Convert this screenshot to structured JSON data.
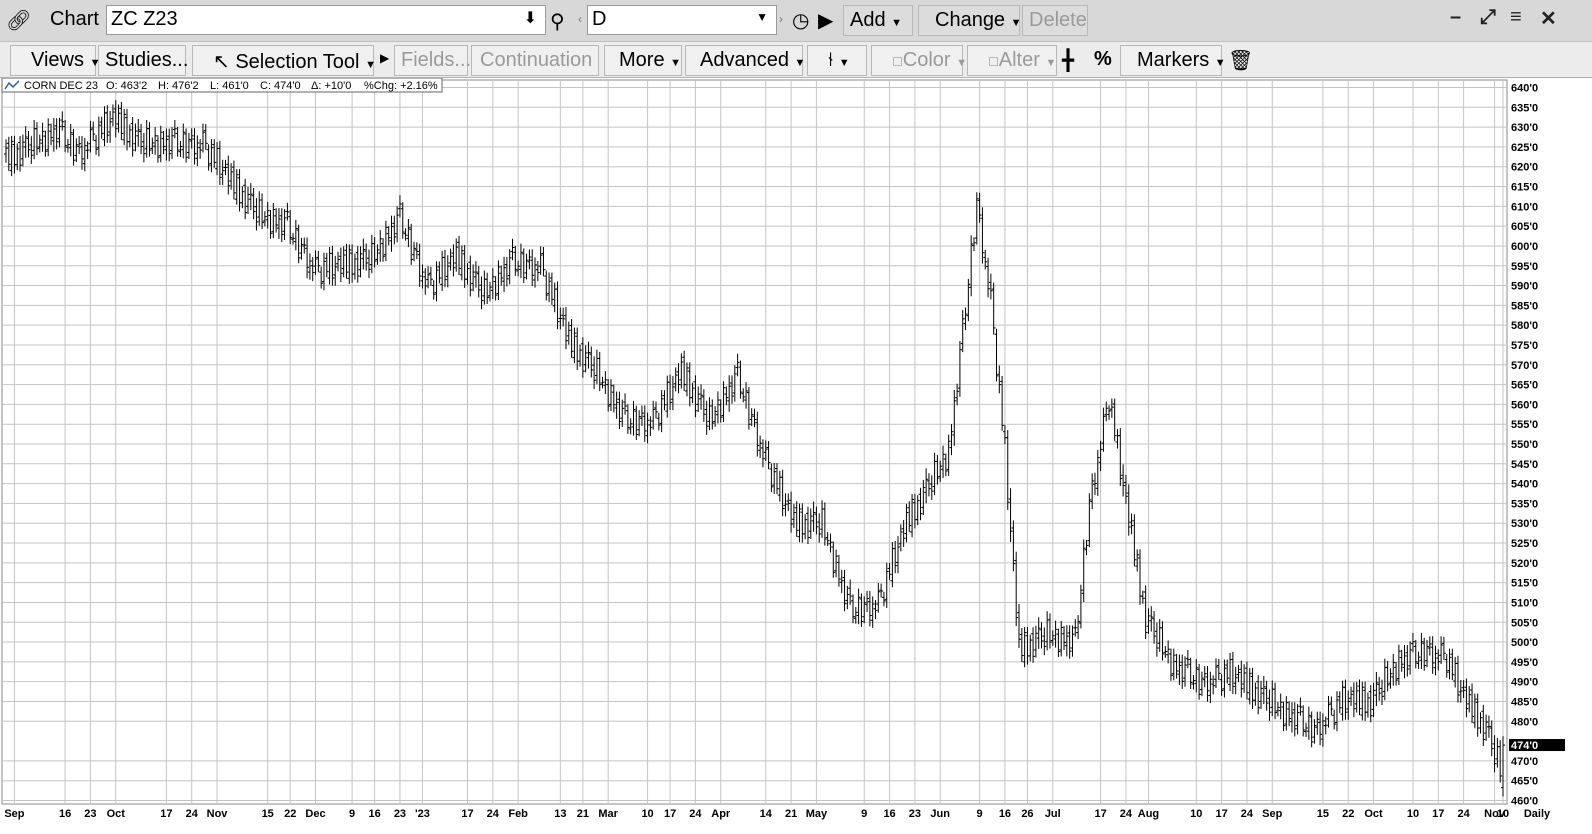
{
  "toolbar": {
    "chart_label": "Chart",
    "symbol_value": "ZC Z23",
    "interval_value": "D",
    "add_label": "Add",
    "change_label": "Change",
    "delete_label": "Delete",
    "views_label": "Views",
    "studies_label": "Studies...",
    "selection_tool_label": "Selection Tool",
    "fields_label": "Fields...",
    "continuation_label": "Continuation",
    "more_label": "More",
    "advanced_label": "Advanced",
    "color_label": "Color",
    "alter_label": "Alter",
    "percent_label": "%",
    "markers_label": "Markers"
  },
  "info_box": {
    "name": "CORN DEC 23",
    "open": "O: 463'2",
    "high": "H: 476'2",
    "low": "L: 461'0",
    "close": "C: 474'0",
    "change": "Δ: +10'0",
    "pct_change": "%Chg: +2.16%"
  },
  "icons": [
    "link-icon",
    "download-arrow-icon",
    "search-icon",
    "clock-icon",
    "play-icon",
    "minimize-icon",
    "expand-icon",
    "menu-icon",
    "close-icon",
    "cursor-icon",
    "crosshair-icon",
    "trash-icon",
    "chart-icon"
  ],
  "colors": {
    "grid": "#c4c4c4",
    "bars": "#000000",
    "last_price_bg": "#000000",
    "last_price_fg": "#ffffff"
  },
  "chart_data": {
    "type": "ohlc",
    "symbol": "CORN DEC 23",
    "frequency_label": "Daily",
    "last_price_label": "474'0",
    "ylim": [
      460,
      640
    ],
    "y_ticks": [
      "640'0",
      "635'0",
      "630'0",
      "625'0",
      "620'0",
      "615'0",
      "610'0",
      "605'0",
      "600'0",
      "595'0",
      "590'0",
      "585'0",
      "580'0",
      "575'0",
      "570'0",
      "565'0",
      "560'0",
      "555'0",
      "550'0",
      "545'0",
      "540'0",
      "535'0",
      "530'0",
      "525'0",
      "520'0",
      "515'0",
      "510'0",
      "505'0",
      "500'0",
      "495'0",
      "490'0",
      "485'0",
      "480'0",
      "474'0",
      "470'0",
      "465'0",
      "460'0"
    ],
    "x_ticks": [
      "Sep",
      "16",
      "23",
      "Oct",
      "17",
      "24",
      "Nov",
      "15",
      "22",
      "Dec",
      "9",
      "16",
      "23",
      "'23",
      "17",
      "24",
      "Feb",
      "13",
      "21",
      "Mar",
      "10",
      "17",
      "24",
      "Apr",
      "14",
      "21",
      "May",
      "9",
      "16",
      "23",
      "Jun",
      "9",
      "16",
      "26",
      "Jul",
      "17",
      "24",
      "Aug",
      "10",
      "17",
      "24",
      "Sep",
      "15",
      "22",
      "Oct",
      "10",
      "17",
      "24",
      "Nov",
      "10"
    ],
    "grid": true,
    "anchors": [
      [
        0,
        622
      ],
      [
        10,
        626
      ],
      [
        18,
        629
      ],
      [
        26,
        624
      ],
      [
        38,
        632
      ],
      [
        48,
        626
      ],
      [
        60,
        626
      ],
      [
        70,
        626
      ],
      [
        80,
        616
      ],
      [
        90,
        608
      ],
      [
        100,
        605
      ],
      [
        110,
        594
      ],
      [
        120,
        595
      ],
      [
        130,
        597
      ],
      [
        140,
        607
      ],
      [
        150,
        590
      ],
      [
        160,
        597
      ],
      [
        170,
        588
      ],
      [
        180,
        596
      ],
      [
        190,
        595
      ],
      [
        200,
        576
      ],
      [
        210,
        568
      ],
      [
        220,
        556
      ],
      [
        230,
        556
      ],
      [
        240,
        568
      ],
      [
        250,
        556
      ],
      [
        260,
        567
      ],
      [
        270,
        546
      ],
      [
        280,
        530
      ],
      [
        290,
        530
      ],
      [
        300,
        508
      ],
      [
        310,
        510
      ],
      [
        320,
        530
      ],
      [
        330,
        542
      ],
      [
        335,
        548
      ],
      [
        340,
        578
      ],
      [
        345,
        611
      ],
      [
        350,
        586
      ],
      [
        355,
        548
      ],
      [
        360,
        498
      ],
      [
        370,
        502
      ],
      [
        380,
        500
      ],
      [
        385,
        535
      ],
      [
        392,
        562
      ],
      [
        398,
        535
      ],
      [
        405,
        506
      ],
      [
        415,
        494
      ],
      [
        425,
        490
      ],
      [
        435,
        492
      ],
      [
        445,
        487
      ],
      [
        455,
        482
      ],
      [
        465,
        478
      ],
      [
        475,
        485
      ],
      [
        485,
        485
      ],
      [
        495,
        495
      ],
      [
        505,
        498
      ],
      [
        512,
        496
      ],
      [
        518,
        486
      ],
      [
        526,
        478
      ],
      [
        532,
        466
      ]
    ],
    "wiggles": [
      3,
      -2,
      4,
      -3,
      1,
      -4,
      2,
      3,
      -1,
      -3,
      4,
      -2,
      0,
      2,
      -4,
      3,
      -1,
      1,
      -3,
      2,
      4,
      -2,
      -1,
      3,
      -4,
      1,
      2,
      -3,
      0,
      -2,
      3,
      1,
      -4,
      2,
      -1,
      4,
      -3,
      0,
      2,
      -2
    ],
    "ranges": [
      8,
      5,
      10,
      6,
      7,
      12,
      5,
      9,
      6,
      8,
      11,
      7,
      5,
      10,
      8,
      6,
      9,
      13,
      7,
      5,
      8,
      10,
      6,
      12,
      7,
      9,
      5,
      8,
      11,
      6
    ]
  }
}
